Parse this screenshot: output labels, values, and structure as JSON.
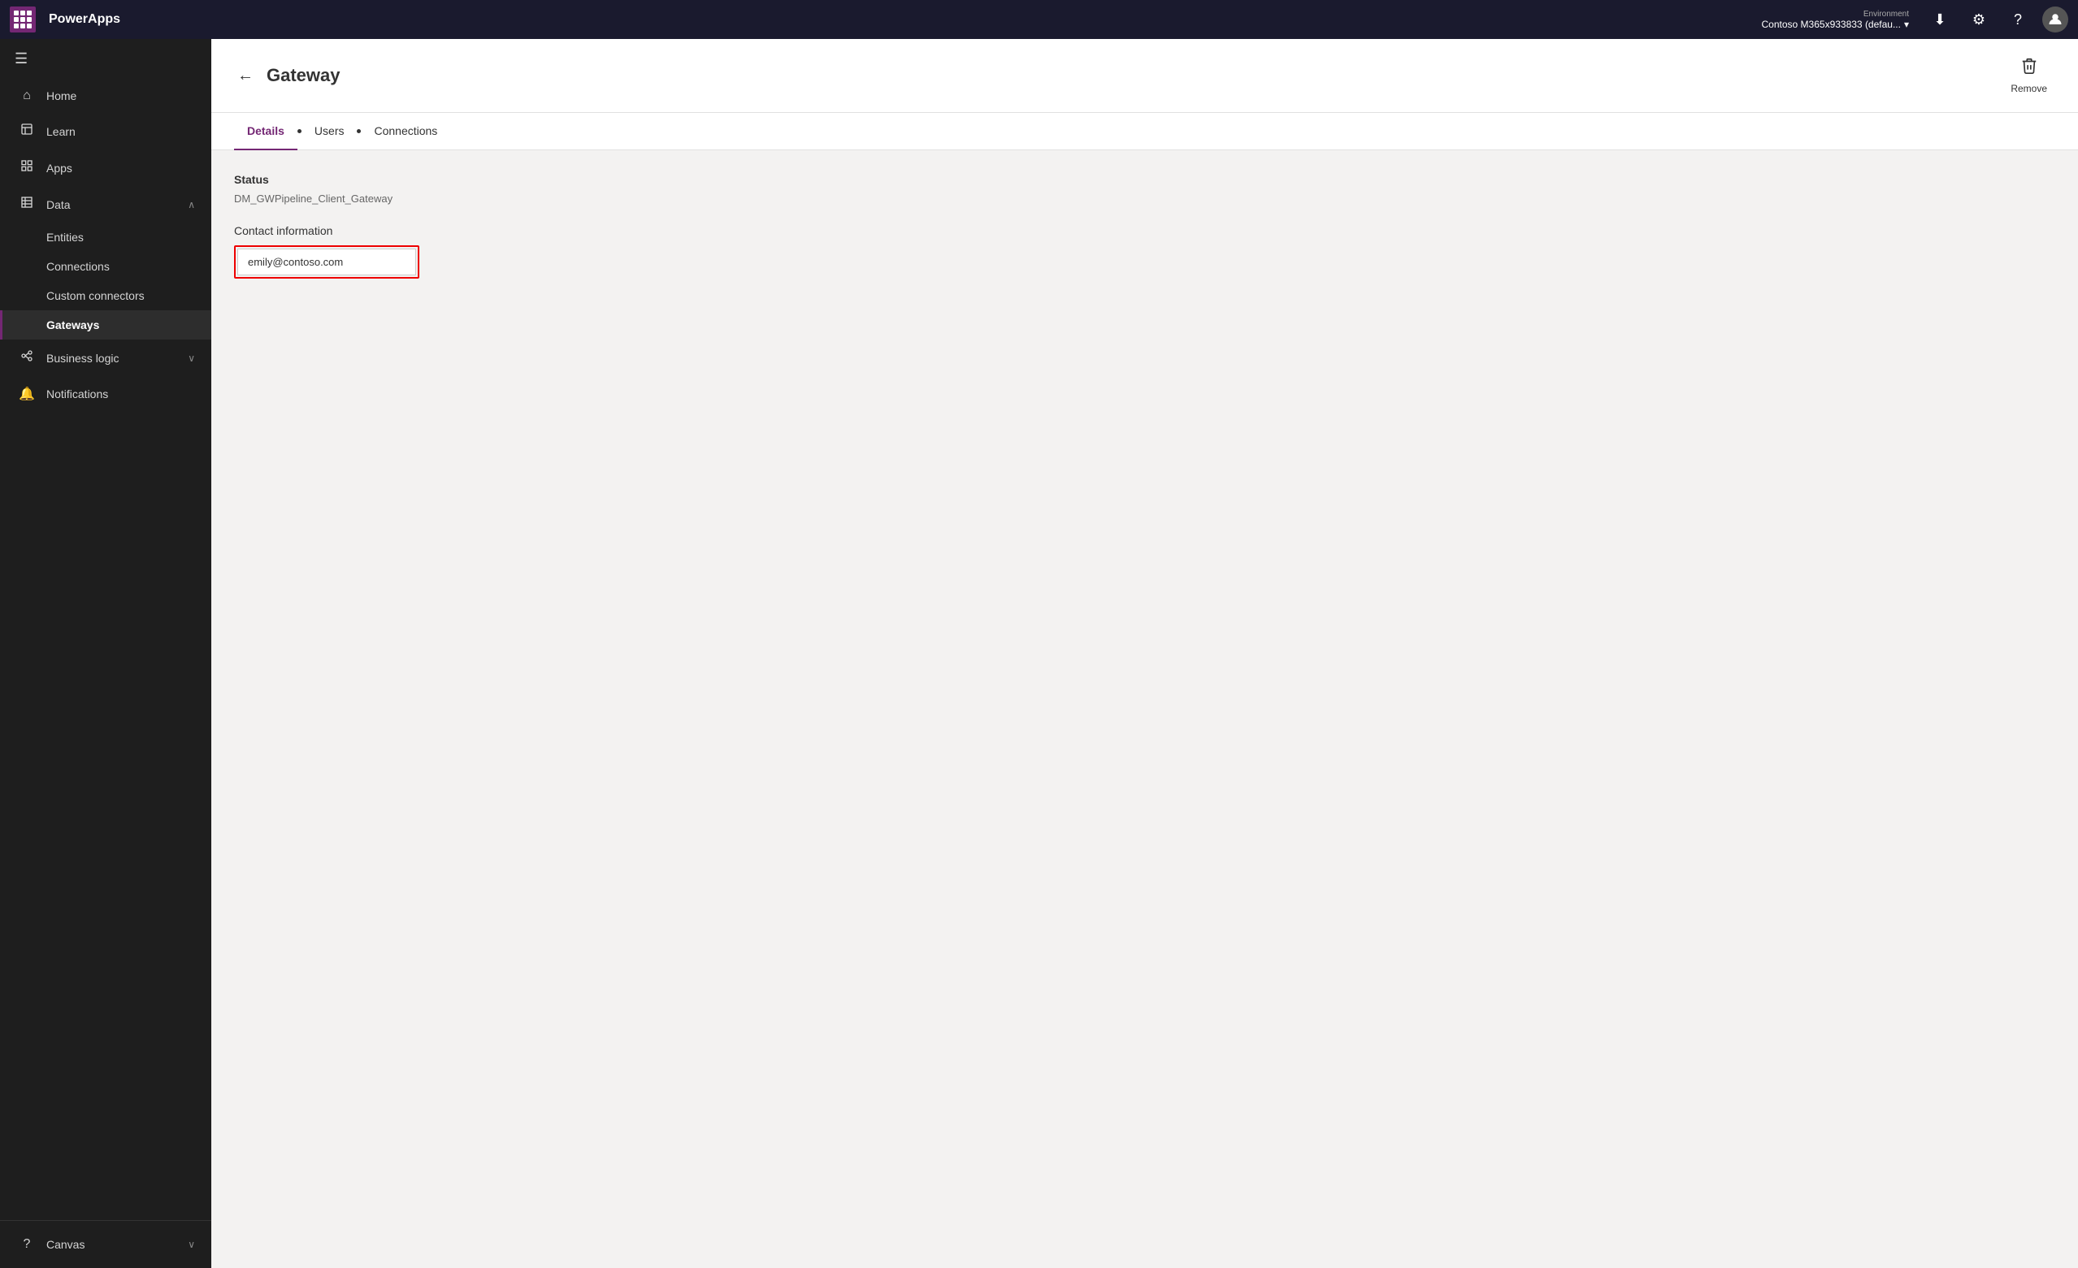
{
  "topbar": {
    "brand": "PowerApps",
    "env_label": "Environment",
    "env_value": "Contoso M365x933833 (defau...",
    "download_icon": "⬇",
    "settings_icon": "⚙",
    "help_icon": "?",
    "avatar_icon": "👤"
  },
  "sidebar": {
    "hamburger_icon": "☰",
    "items": [
      {
        "id": "home",
        "icon": "⌂",
        "label": "Home",
        "active": false
      },
      {
        "id": "learn",
        "icon": "📖",
        "label": "Learn",
        "active": false
      },
      {
        "id": "apps",
        "icon": "⊞",
        "label": "Apps",
        "active": false
      },
      {
        "id": "data",
        "icon": "▦",
        "label": "Data",
        "active": false,
        "expandable": true,
        "expanded": true
      },
      {
        "id": "entities",
        "icon": "",
        "label": "Entities",
        "active": false,
        "sub": true
      },
      {
        "id": "connections",
        "icon": "",
        "label": "Connections",
        "active": false,
        "sub": true
      },
      {
        "id": "custom-connectors",
        "icon": "",
        "label": "Custom connectors",
        "active": false,
        "sub": true
      },
      {
        "id": "gateways",
        "icon": "",
        "label": "Gateways",
        "active": true,
        "sub": true
      },
      {
        "id": "business-logic",
        "icon": "↗",
        "label": "Business logic",
        "active": false,
        "expandable": true
      },
      {
        "id": "notifications",
        "icon": "🔔",
        "label": "Notifications",
        "active": false
      }
    ],
    "bottom": {
      "canvas_label": "Canvas",
      "canvas_icon": "?"
    }
  },
  "page": {
    "back_label": "←",
    "title": "Gateway",
    "remove_label": "Remove"
  },
  "tabs": [
    {
      "id": "details",
      "label": "Details",
      "active": true
    },
    {
      "id": "users",
      "label": "Users",
      "active": false
    },
    {
      "id": "connections",
      "label": "Connections",
      "active": false
    }
  ],
  "content": {
    "status_label": "Status",
    "status_value": "DM_GWPipeline_Client_Gateway",
    "contact_label": "Contact information",
    "contact_value": "emily@contoso.com"
  }
}
